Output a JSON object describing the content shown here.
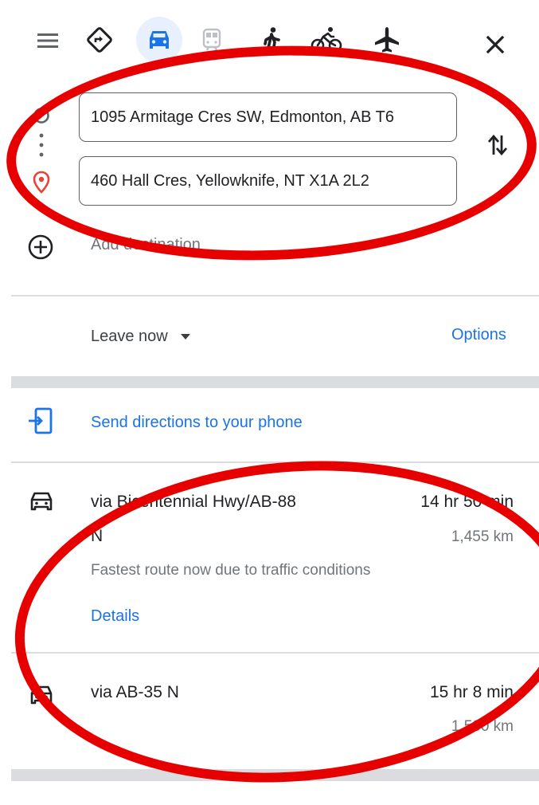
{
  "travel_modes": [
    {
      "name": "best",
      "icon": "directions-diamond-icon"
    },
    {
      "name": "driving",
      "icon": "car-icon",
      "selected": true
    },
    {
      "name": "transit",
      "icon": "train-icon"
    },
    {
      "name": "walking",
      "icon": "walking-icon"
    },
    {
      "name": "cycling",
      "icon": "bicycle-icon"
    },
    {
      "name": "flights",
      "icon": "airplane-icon"
    }
  ],
  "origin": {
    "value": "1095 Armitage Cres SW, Edmonton, AB T6"
  },
  "destination": {
    "value": "460 Hall Cres, Yellowknife, NT X1A 2L2"
  },
  "add_destination": {
    "label": "Add destination"
  },
  "departure": {
    "label": "Leave now"
  },
  "options": {
    "label": "Options"
  },
  "send_to_phone": {
    "label": "Send directions to your phone"
  },
  "routes": [
    {
      "title_line1": "via Bicentennial Hwy/AB-88",
      "title_line2": "N",
      "duration": "14 hr 50 min",
      "distance": "1,455 km",
      "note": "Fastest route now due to traffic conditions",
      "details_label": "Details"
    },
    {
      "title_line1": "via AB-35 N",
      "duration": "15 hr 8 min",
      "distance": "1,500 km"
    }
  ],
  "colors": {
    "accent": "#1a73e8",
    "annotation": "#e60000",
    "selected_mode_bg": "#e8f0fe",
    "destination_pin": "#ea4335"
  }
}
